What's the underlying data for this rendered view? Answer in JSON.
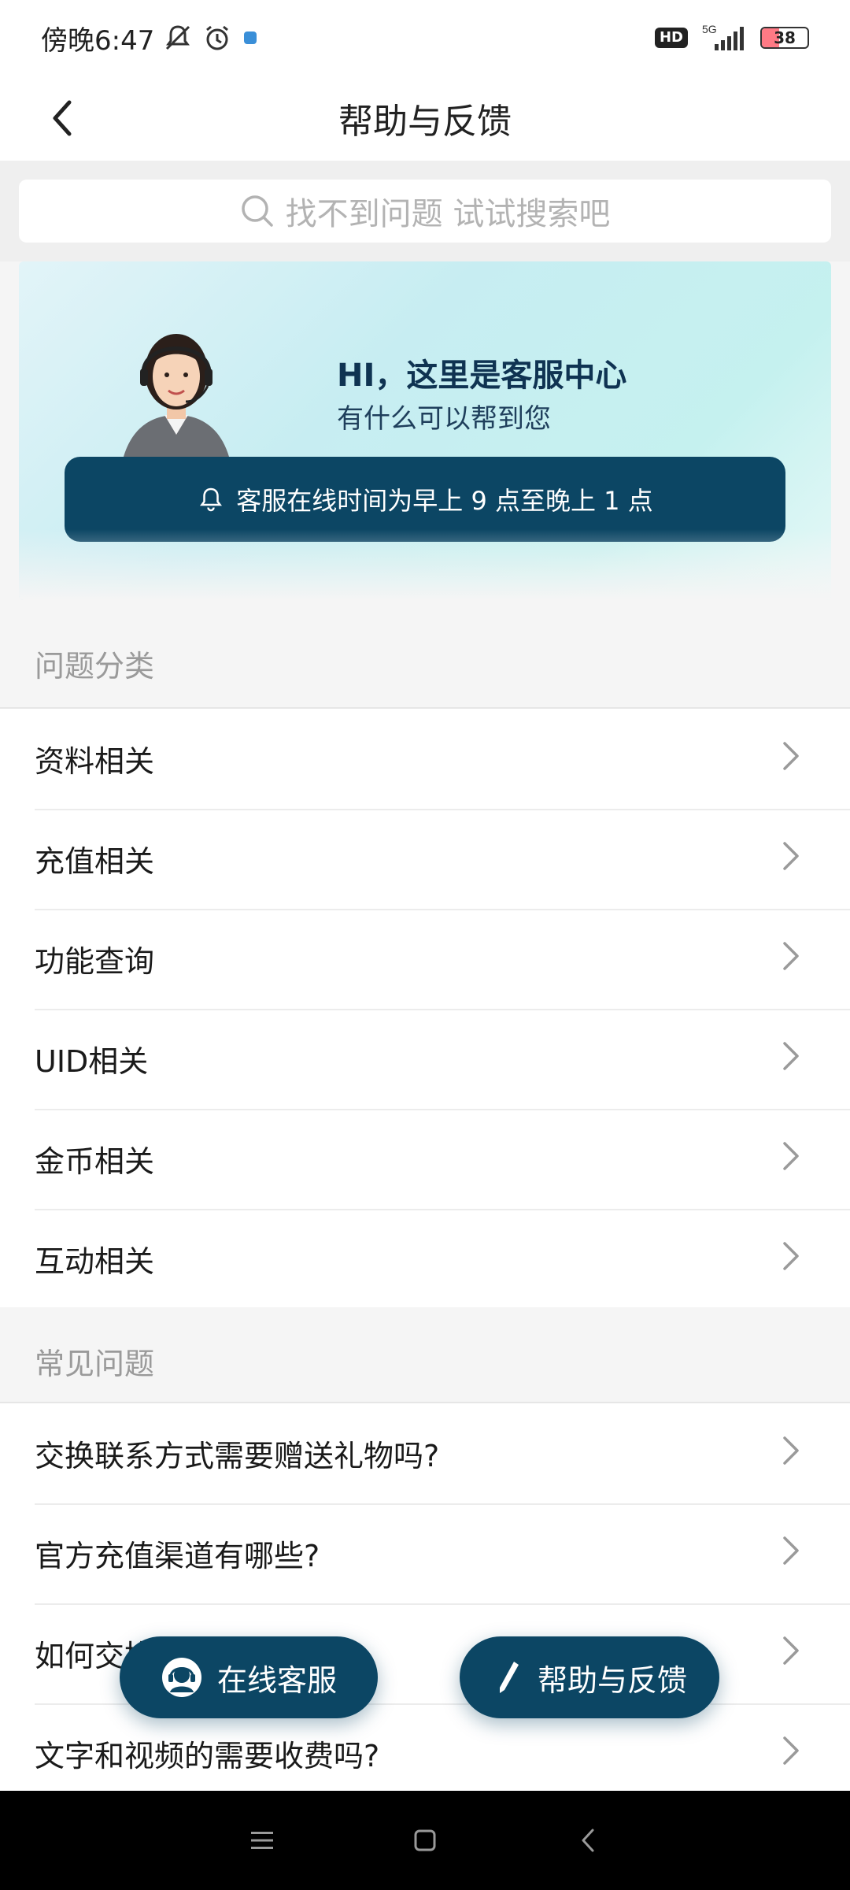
{
  "status_bar": {
    "time": "傍晚6:47",
    "network": "5G",
    "hd_label": "HD",
    "battery": "38",
    "battery_level": 0.38
  },
  "header": {
    "title": "帮助与反馈"
  },
  "search": {
    "placeholder": "找不到问题 试试搜索吧"
  },
  "banner": {
    "title": "HI，这里是客服中心",
    "subtitle": "有什么可以帮到您",
    "notice": "客服在线时间为早上 9 点至晚上 1 点"
  },
  "categories": {
    "title": "问题分类",
    "items": [
      {
        "label": "资料相关"
      },
      {
        "label": "充值相关"
      },
      {
        "label": "功能查询"
      },
      {
        "label": "UID相关"
      },
      {
        "label": "金币相关"
      },
      {
        "label": "互动相关"
      }
    ]
  },
  "faq": {
    "title": "常见问题",
    "items": [
      {
        "label": "交换联系方式需要赠送礼物吗?"
      },
      {
        "label": "官方充值渠道有哪些?"
      },
      {
        "label": "如何交换联系方式?"
      },
      {
        "label": "文字和视频的需要收费吗?"
      }
    ]
  },
  "fab": {
    "service_label": "在线客服",
    "feedback_label": "帮助与反馈"
  },
  "colors": {
    "accent": "#0c4664",
    "banner_bg": "#c7edf2",
    "section_text": "#9a9a9a"
  }
}
